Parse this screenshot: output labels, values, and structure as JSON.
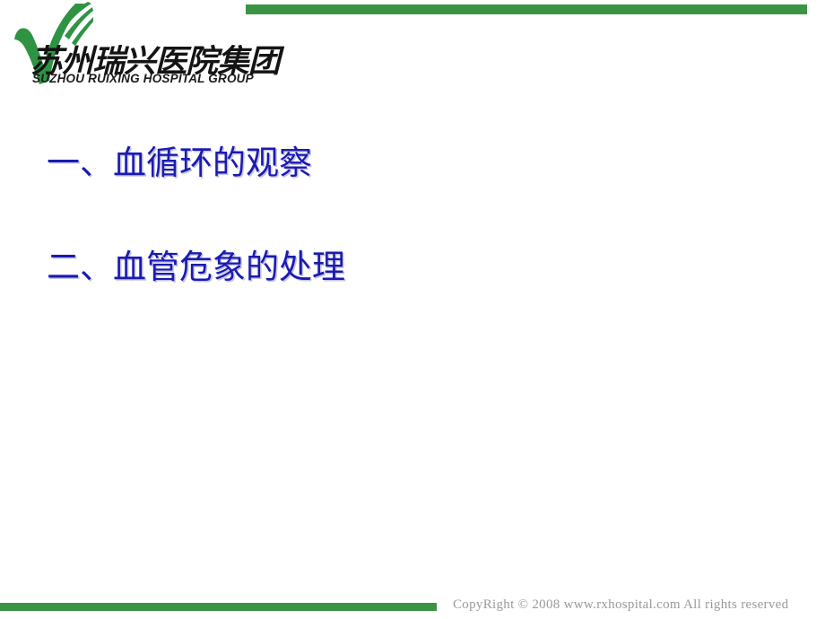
{
  "slide": {
    "background_color": "#ffffff",
    "accent_color": "#3b9444",
    "heading_color": "#1a1ab4",
    "footer_color": "#9a9a9a"
  },
  "header": {
    "logo": {
      "icon_name": "green-swoosh-checkmark-logo",
      "name_cn": "苏州瑞兴医院集团",
      "name_en": "SUZHOU RUIXING HOSPITAL GROUP",
      "mark_color": "#2e9443"
    },
    "accent_bar_color": "#3b9444"
  },
  "main": {
    "bullets": [
      {
        "label": "一、血循环的观察"
      },
      {
        "label": "二、血管危象的处理"
      }
    ]
  },
  "footer": {
    "accent_bar_color": "#3b9444",
    "copyright": "CopyRight  © 2008  www.rxhospital.com   All rights reserved"
  }
}
